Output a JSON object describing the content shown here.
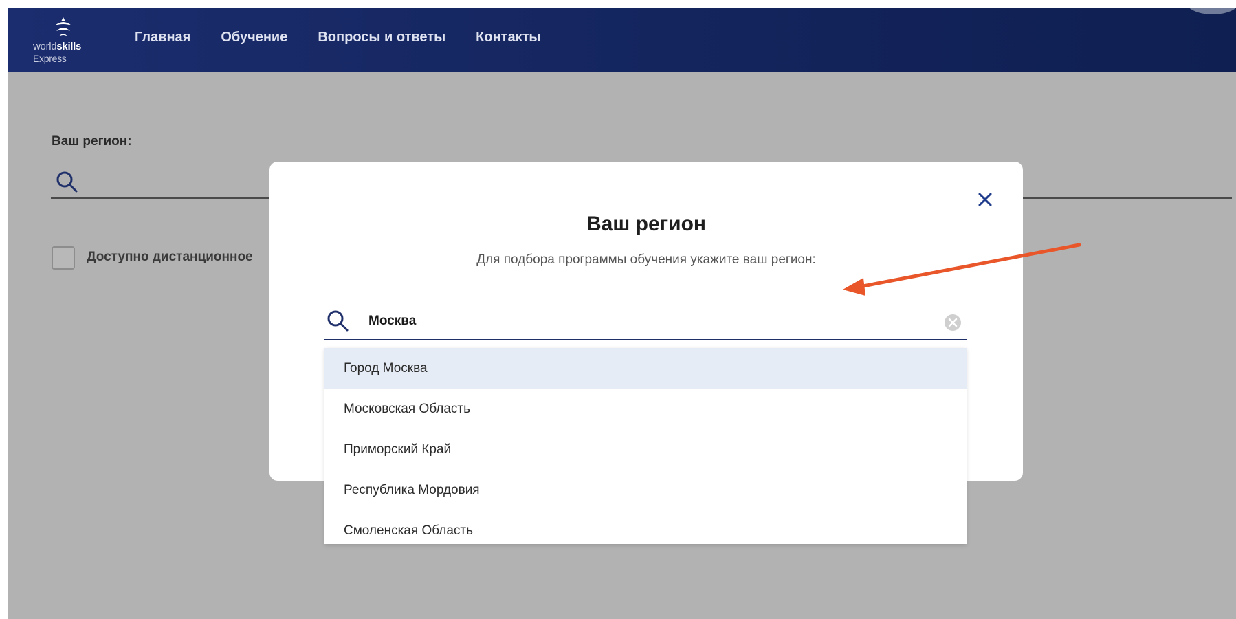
{
  "header": {
    "logo_line1_a": "world",
    "logo_line1_b": "skills",
    "logo_line2": "Express",
    "nav": [
      {
        "label": "Главная"
      },
      {
        "label": "Обучение"
      },
      {
        "label": "Вопросы и ответы"
      },
      {
        "label": "Контакты"
      }
    ]
  },
  "background_form": {
    "region_label": "Ваш регион:",
    "checkbox_label": "Доступно дистанционное"
  },
  "modal": {
    "title": "Ваш регион",
    "subtitle": "Для подбора программы обучения укажите ваш регион:",
    "search_value": "Москва",
    "close_icon": "close-icon",
    "clear_icon": "clear-icon"
  },
  "dropdown": {
    "items": [
      {
        "label": "Город Москва"
      },
      {
        "label": "Московская Область"
      },
      {
        "label": "Приморский Край"
      },
      {
        "label": "Республика Мордовия"
      },
      {
        "label": "Смоленская Область"
      }
    ],
    "highlighted_index": 0
  },
  "colors": {
    "header_bg": "#13245c",
    "overlay_bg": "#b2b2b2",
    "accent": "#1e2f6a",
    "annotation_arrow": "#e8562a",
    "highlight_row": "#e6ecf5"
  }
}
